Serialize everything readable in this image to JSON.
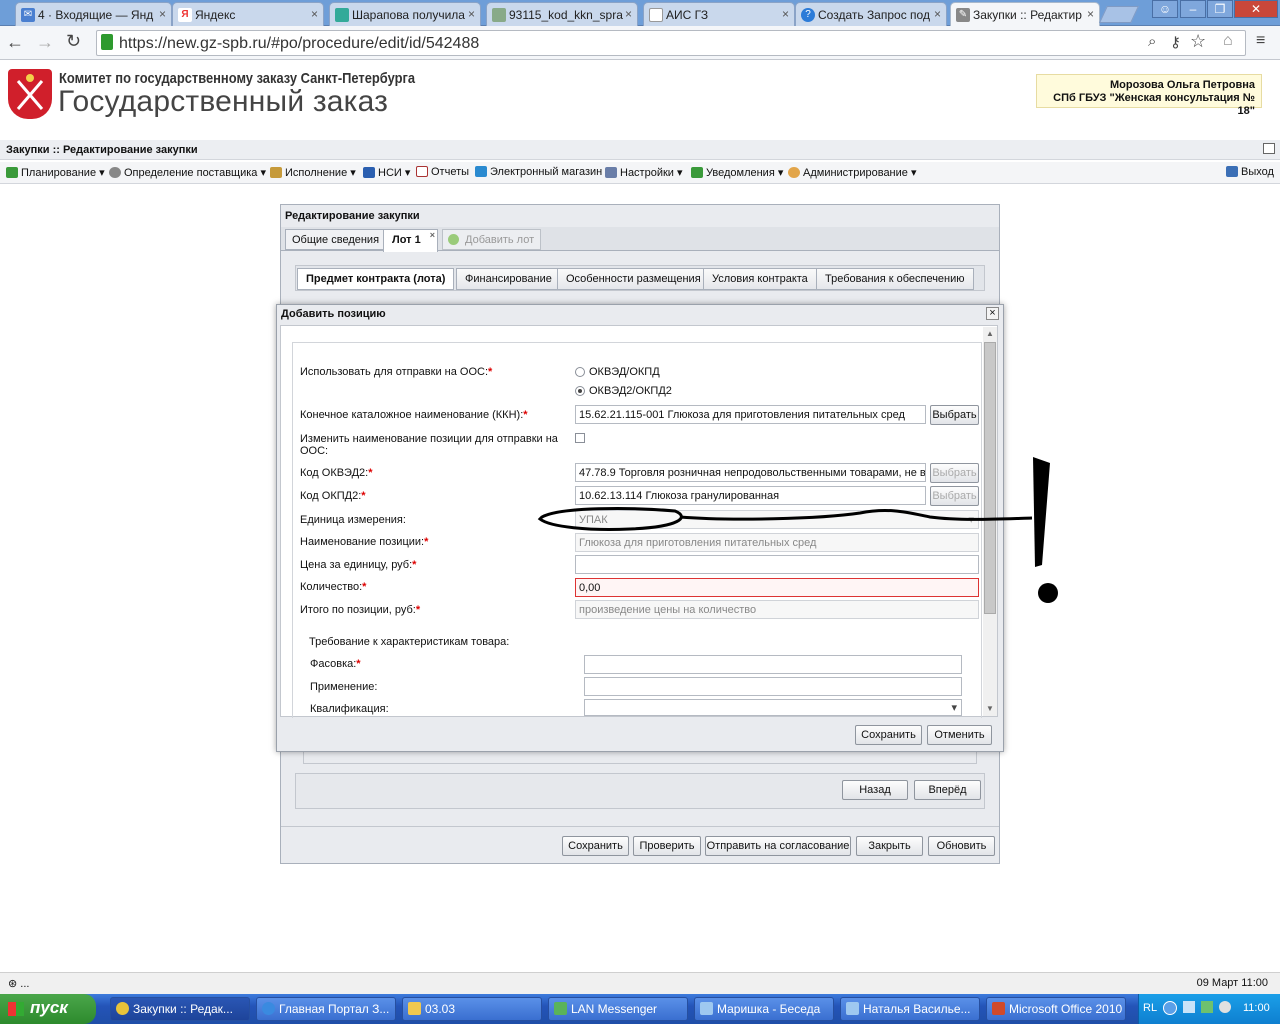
{
  "browser": {
    "tabs": [
      {
        "label": "4 · Входящие — Янд",
        "icon": "mail-icon",
        "color": "#4a7fd0"
      },
      {
        "label": "Яндекс",
        "icon": "yandex-icon",
        "color": "#e33"
      },
      {
        "label": "Шарапова получила",
        "icon": "news-icon",
        "color": "#3a9"
      },
      {
        "label": "93115_kod_kkn_spra",
        "icon": "file-icon",
        "color": "#8a8"
      },
      {
        "label": "АИС ГЗ",
        "icon": "page-icon",
        "color": "#999"
      },
      {
        "label": "Создать Запрос под",
        "icon": "help-icon",
        "color": "#2b7bd8"
      },
      {
        "label": "Закупки :: Редактир",
        "icon": "tools-icon",
        "color": "#777"
      }
    ],
    "url": "https://new.gz-spb.ru/#po/procedure/edit/id/542488"
  },
  "header": {
    "org_line": "Комитет по государственному заказу Санкт-Петербурга",
    "title": "Государственный заказ",
    "user_name": "Морозова Ольга Петровна",
    "user_org": "СПб ГБУЗ \"Женская консультация № 18\""
  },
  "breadcrumb": "Закупки :: Редактирование закупки",
  "menu": {
    "items": [
      "Планирование",
      "Определение поставщика",
      "Исполнение",
      "НСИ",
      "Отчеты",
      "Электронный магазин",
      "Настройки",
      "Уведомления",
      "Администрирование"
    ],
    "exit": "Выход"
  },
  "panel": {
    "title": "Редактирование закупки",
    "tabs": [
      "Общие сведения",
      "Лот 1",
      "Добавить лот"
    ],
    "subtabs": [
      "Предмет контракта (лота)",
      "Финансирование",
      "Особенности размещения",
      "Условия контракта",
      "Требования к обеспечению"
    ],
    "nav_back": "Назад",
    "nav_forward": "Вперёд",
    "bottom_buttons": [
      "Сохранить",
      "Проверить",
      "Отправить на согласование",
      "Закрыть",
      "Обновить"
    ]
  },
  "dialog": {
    "title": "Добавить позицию",
    "fields": {
      "use_for_oos": "Использовать для отправки на ООС:",
      "radio_1": "ОКВЭД/ОКПД",
      "radio_2": "ОКВЭД2/ОКПД2",
      "kkn_label": "Конечное каталожное наименование (ККН):",
      "kkn_value": "15.62.21.115-001 Глюкоза для приготовления питательных сред",
      "rename_label_1": "Изменить наименование позиции для отправки на",
      "rename_label_2": "ООС:",
      "okved2_label": "Код ОКВЭД2:",
      "okved2_value": "47.78.9 Торговля розничная непродовольственными товарами, не в",
      "okpd2_label": "Код ОКПД2:",
      "okpd2_value": "10.62.13.114 Глюкоза гранулированная",
      "unit_label": "Единица измерения:",
      "unit_value": "УПАК",
      "name_label": "Наименование позиции:",
      "name_value": "Глюкоза для приготовления питательных сред",
      "price_label": "Цена за единицу, руб:",
      "price_value": "",
      "qty_label": "Количество:",
      "qty_value": "0,00",
      "total_label": "Итого по позиции, руб:",
      "total_placeholder": "произведение цены на количество",
      "req_header": "Требование к характеристикам товара:",
      "pack_label": "Фасовка:",
      "use_label": "Применение:",
      "qual_label": "Квалификация:"
    },
    "select_button": "Выбрать",
    "save": "Сохранить",
    "cancel": "Отменить"
  },
  "status_bar": {
    "left": "⊛ ...",
    "right": "09 Март 11:00"
  },
  "taskbar": {
    "start": "пуск",
    "tasks": [
      "Закупки :: Редак...",
      "Главная Портал З...",
      "03.03",
      "LAN Messenger",
      "Маришка - Беседа",
      "Наталья Василье...",
      "Microsoft Office 2010"
    ],
    "lang": "RL",
    "clock": "11:00"
  }
}
